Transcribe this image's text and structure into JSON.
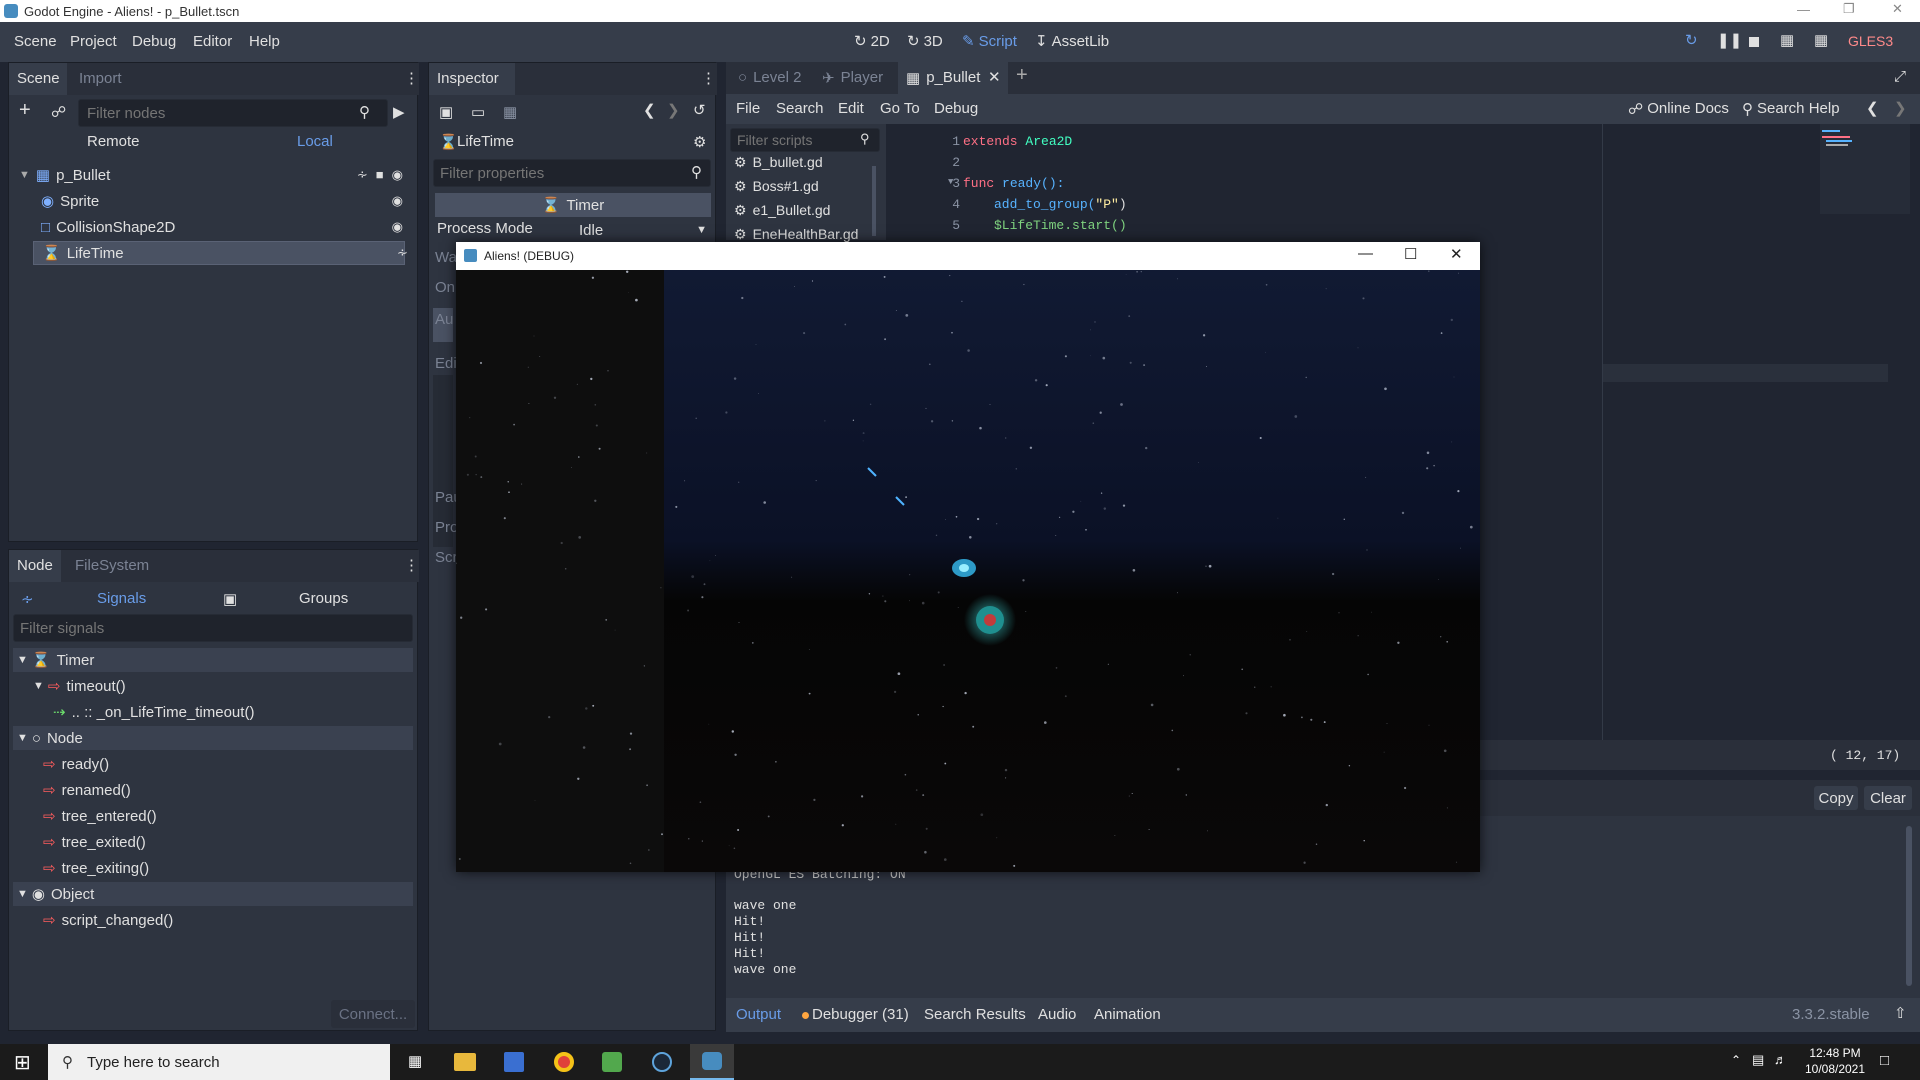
{
  "window": {
    "title": "Godot Engine - Aliens! - p_Bullet.tscn"
  },
  "menu": {
    "items": [
      "Scene",
      "Project",
      "Debug",
      "Editor",
      "Help"
    ]
  },
  "workspaces": {
    "w2d": "2D",
    "w3d": "3D",
    "script": "Script",
    "assetlib": "AssetLib"
  },
  "renderer": "GLES3",
  "scene_dock": {
    "tabs": [
      "Scene",
      "Import"
    ],
    "filter_placeholder": "Filter nodes",
    "remote": "Remote",
    "local": "Local",
    "nodes": [
      {
        "name": "p_Bullet",
        "icon": "area2d-icon"
      },
      {
        "name": "Sprite",
        "icon": "sprite-icon"
      },
      {
        "name": "CollisionShape2D",
        "icon": "collision-icon"
      },
      {
        "name": "LifeTime",
        "icon": "timer-icon"
      }
    ]
  },
  "node_dock": {
    "tabs": [
      "Node",
      "FileSystem"
    ],
    "signals_tab": "Signals",
    "groups_tab": "Groups",
    "filter_placeholder": "Filter signals",
    "timer_category": "Timer",
    "timeout_signal": "timeout()",
    "connection": ".. :: _on_LifeTime_timeout()",
    "node_category": "Node",
    "node_signals": [
      "ready()",
      "renamed()",
      "tree_entered()",
      "tree_exited()",
      "tree_exiting()"
    ],
    "object_category": "Object",
    "object_signals": [
      "script_changed()"
    ],
    "connect_button": "Connect..."
  },
  "inspector": {
    "title": "Inspector",
    "object_name": "LifeTime",
    "filter_placeholder": "Filter properties",
    "class_header": "Timer",
    "process_mode_label": "Process Mode",
    "process_mode_value": "Idle",
    "clipped_labels": [
      "Wa",
      "On",
      "Au",
      "Edi",
      "Pau",
      "Pro",
      "Scr"
    ]
  },
  "editor_tabs": [
    {
      "label": "Level 2",
      "icon": "node-icon"
    },
    {
      "label": "Player",
      "icon": "player-icon"
    },
    {
      "label": "p_Bullet",
      "icon": "area2d-icon",
      "active": true
    }
  ],
  "script_menu": {
    "items": [
      "File",
      "Search",
      "Edit",
      "Go To",
      "Debug"
    ],
    "online_docs": "Online Docs",
    "search_help": "Search Help"
  },
  "scripts": {
    "filter_placeholder": "Filter scripts",
    "files": [
      "B_bullet.gd",
      "Boss#1.gd",
      "e1_Bullet.gd",
      "EneHealthBar.gd"
    ]
  },
  "code": {
    "line_numbers": [
      "1",
      "2",
      "3",
      "4",
      "5"
    ],
    "l1_kw": "extends",
    "l1_type": "Area2D",
    "l3_kw": "func",
    "l3_fn": "ready():",
    "l4_fn": "add_to_group(",
    "l4_str": "\"P\"",
    "l4_end": ")",
    "l5": "$LifeTime.start()",
    "cursor_pos": "( 12, 17)"
  },
  "output": {
    "copy": "Copy",
    "clear": "Clear",
    "partial_line": "OpenGL ES Batching: ON",
    "lines": [
      "wave one",
      "Hit!",
      "Hit!",
      "Hit!",
      "wave one"
    ]
  },
  "bottom_tabs": [
    "Output",
    "Debugger (31)",
    "Search Results",
    "Audio",
    "Animation"
  ],
  "version": "3.3.2.stable",
  "game_window": {
    "title": "Aliens! (DEBUG)"
  },
  "taskbar": {
    "search_placeholder": "Type here to search",
    "time": "12:48 PM",
    "date": "10/08/2021"
  },
  "colors": {
    "accent": "#699ce8",
    "editor_bg": "#202531",
    "panel": "#2e3440",
    "signal": "#ff5d5d"
  }
}
